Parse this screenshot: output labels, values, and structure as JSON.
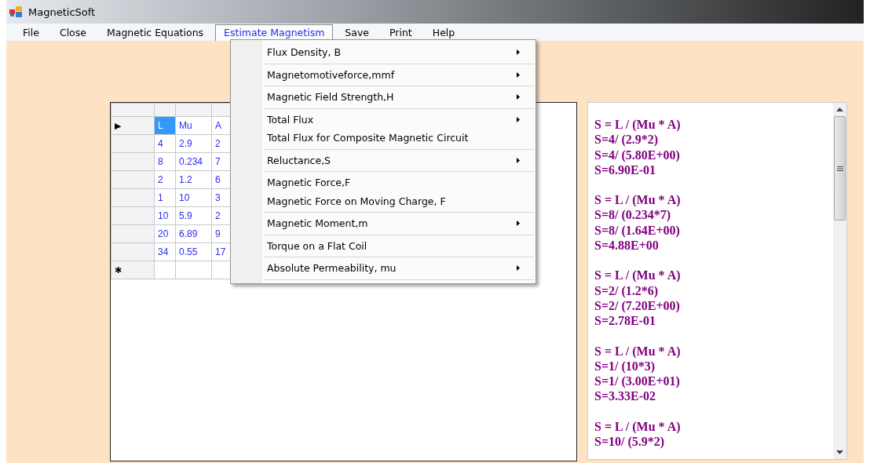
{
  "window": {
    "title": "MagneticSoft"
  },
  "menu_bar": [
    {
      "label": "File",
      "selected": false
    },
    {
      "label": "Close",
      "selected": false
    },
    {
      "label": "Magnetic Equations",
      "selected": false
    },
    {
      "label": "Estimate Magnetism",
      "selected": true
    },
    {
      "label": "Save",
      "selected": false
    },
    {
      "label": "Print",
      "selected": false
    },
    {
      "label": "Help",
      "selected": false
    }
  ],
  "dropdown": {
    "groups": [
      [
        {
          "label": "Flux Density, B",
          "has_submenu": true
        }
      ],
      [
        {
          "label": "Magnetomotiveforce,mmf",
          "has_submenu": true
        }
      ],
      [
        {
          "label": "Magnetic Field Strength,H",
          "has_submenu": true
        }
      ],
      [
        {
          "label": "Total Flux",
          "has_submenu": true
        },
        {
          "label": "Total Flux for Composite Magnetic Circuit",
          "has_submenu": false
        }
      ],
      [
        {
          "label": "Reluctance,S",
          "has_submenu": true
        }
      ],
      [
        {
          "label": "Magnetic Force,F",
          "has_submenu": false
        },
        {
          "label": "Magnetic Force on Moving Charge, F",
          "has_submenu": false
        }
      ],
      [
        {
          "label": "Magnetic Moment,m",
          "has_submenu": true
        }
      ],
      [
        {
          "label": "Torque on a Flat Coil",
          "has_submenu": false
        }
      ],
      [
        {
          "label": "Absolute Permeability, mu",
          "has_submenu": true
        }
      ]
    ]
  },
  "grid": {
    "rows": [
      {
        "marker": "▶",
        "cells": [
          {
            "text": "L",
            "selected": true
          },
          {
            "text": "Mu",
            "selected": false
          },
          {
            "text": "A",
            "selected": false
          }
        ]
      },
      {
        "cells": [
          {
            "text": "4",
            "selected": false
          },
          {
            "text": "2.9",
            "selected": false
          },
          {
            "text": "2",
            "selected": false
          }
        ]
      },
      {
        "cells": [
          {
            "text": "8",
            "selected": false
          },
          {
            "text": "0.234",
            "selected": false
          },
          {
            "text": "7",
            "selected": false
          }
        ]
      },
      {
        "cells": [
          {
            "text": "2",
            "selected": false
          },
          {
            "text": "1.2",
            "selected": false
          },
          {
            "text": "6",
            "selected": false
          }
        ]
      },
      {
        "cells": [
          {
            "text": "1",
            "selected": false
          },
          {
            "text": "10",
            "selected": false
          },
          {
            "text": "3",
            "selected": false
          }
        ]
      },
      {
        "cells": [
          {
            "text": "10",
            "selected": false
          },
          {
            "text": "5.9",
            "selected": false
          },
          {
            "text": "2",
            "selected": false
          }
        ]
      },
      {
        "cells": [
          {
            "text": "20",
            "selected": false
          },
          {
            "text": "6.89",
            "selected": false
          },
          {
            "text": "9",
            "selected": false
          }
        ]
      },
      {
        "cells": [
          {
            "text": "34",
            "selected": false
          },
          {
            "text": "0.55",
            "selected": false
          },
          {
            "text": "17",
            "selected": false
          }
        ]
      },
      {
        "marker": "✱",
        "cells": [
          {
            "text": "",
            "selected": false
          },
          {
            "text": "",
            "selected": false
          },
          {
            "text": "",
            "selected": false
          }
        ]
      }
    ]
  },
  "results": [
    [
      "S = L / (Mu * A)",
      "S=4/ (2.9*2)",
      "S=4/ (5.80E+00)",
      "S=6.90E-01"
    ],
    [
      "S = L / (Mu * A)",
      "S=8/ (0.234*7)",
      "S=8/ (1.64E+00)",
      "S=4.88E+00"
    ],
    [
      "S = L / (Mu * A)",
      "S=2/ (1.2*6)",
      "S=2/ (7.20E+00)",
      "S=2.78E-01"
    ],
    [
      "S = L / (Mu * A)",
      "S=1/ (10*3)",
      "S=1/ (3.00E+01)",
      "S=3.33E-02"
    ],
    [
      "S = L / (Mu * A)",
      "S=10/ (5.9*2)"
    ]
  ]
}
